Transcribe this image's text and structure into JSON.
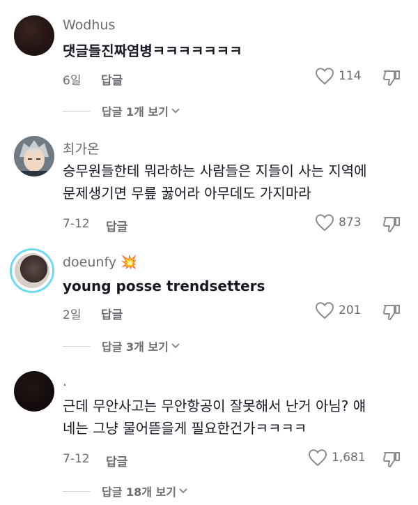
{
  "comments": [
    {
      "username": "Wodhus",
      "text_lines": [
        "댓글들진짜염병ㅋㅋㅋㅋㅋㅋㅋ"
      ],
      "time": "6일",
      "reply_label": "답글",
      "likes": "114",
      "view_replies": "답글 1개 보기"
    },
    {
      "username": "최가온",
      "text_lines": [
        "승무원들한테 뭐라하는 사람들은 지들이 사는 지역에",
        "문제생기면 무릎 꿇어라 아무데도 가지마라"
      ],
      "time": "7-12",
      "reply_label": "답글",
      "likes": "873"
    },
    {
      "username": "doeunfy",
      "flair_emoji": "💥",
      "text_lines": [
        "young posse trendsetters"
      ],
      "time": "2일",
      "reply_label": "답글",
      "likes": "201",
      "view_replies": "답글 3개 보기"
    },
    {
      "username": ".",
      "text_lines": [
        "근데 무안사고는 무안항공이 잘못해서 난거 아님? 얘",
        "네는 그냥 물어뜯을게 필요한건가ㅋㅋㅋㅋ"
      ],
      "time": "7-12",
      "reply_label": "답글",
      "likes": "1,681",
      "view_replies": "답글 18개 보기"
    }
  ],
  "colors": {
    "ring": "#6fd8f2",
    "secondary_text": "#6b6b72",
    "primary_text": "#161823"
  },
  "icons": [
    "heart-outline-icon",
    "dislike-icon",
    "chevron-down-icon"
  ]
}
